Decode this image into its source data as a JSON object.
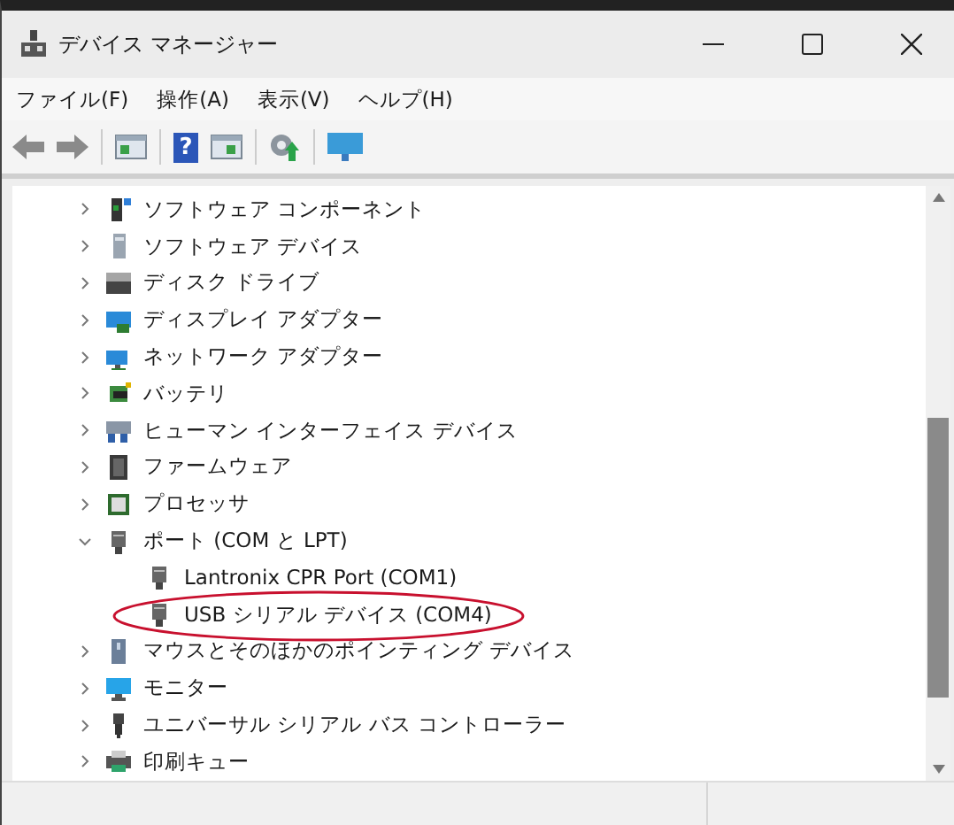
{
  "window": {
    "title": "デバイス マネージャー"
  },
  "menu": [
    "ファイル(F)",
    "操作(A)",
    "表示(V)",
    "ヘルプ(H)"
  ],
  "toolbar": [
    {
      "kind": "back",
      "disabled": true
    },
    {
      "kind": "forward",
      "disabled": true
    },
    {
      "kind": "sep"
    },
    {
      "kind": "panel"
    },
    {
      "kind": "sep"
    },
    {
      "kind": "help",
      "glyph": "?"
    },
    {
      "kind": "panel2"
    },
    {
      "kind": "sep"
    },
    {
      "kind": "update"
    },
    {
      "kind": "sep"
    },
    {
      "kind": "monitor"
    }
  ],
  "tree": [
    {
      "label": "ソフトウェア コンポーネント",
      "expanded": false
    },
    {
      "label": "ソフトウェア デバイス",
      "expanded": false
    },
    {
      "label": "ディスク ドライブ",
      "expanded": false
    },
    {
      "label": "ディスプレイ アダプター",
      "expanded": false
    },
    {
      "label": "ネットワーク アダプター",
      "expanded": false
    },
    {
      "label": "バッテリ",
      "expanded": false
    },
    {
      "label": "ヒューマン インターフェイス デバイス",
      "expanded": false
    },
    {
      "label": "ファームウェア",
      "expanded": false
    },
    {
      "label": "プロセッサ",
      "expanded": false
    },
    {
      "label": "ポート (COM と LPT)",
      "expanded": true,
      "children": [
        {
          "label": "Lantronix CPR Port (COM1)",
          "circled": false
        },
        {
          "label": "USB シリアル デバイス (COM4)",
          "circled": true
        }
      ]
    },
    {
      "label": "マウスとそのほかのポインティング デバイス",
      "expanded": false
    },
    {
      "label": "モニター",
      "expanded": false
    },
    {
      "label": "ユニバーサル シリアル バス コントローラー",
      "expanded": false
    },
    {
      "label": "印刷キュー",
      "expanded": false
    }
  ]
}
